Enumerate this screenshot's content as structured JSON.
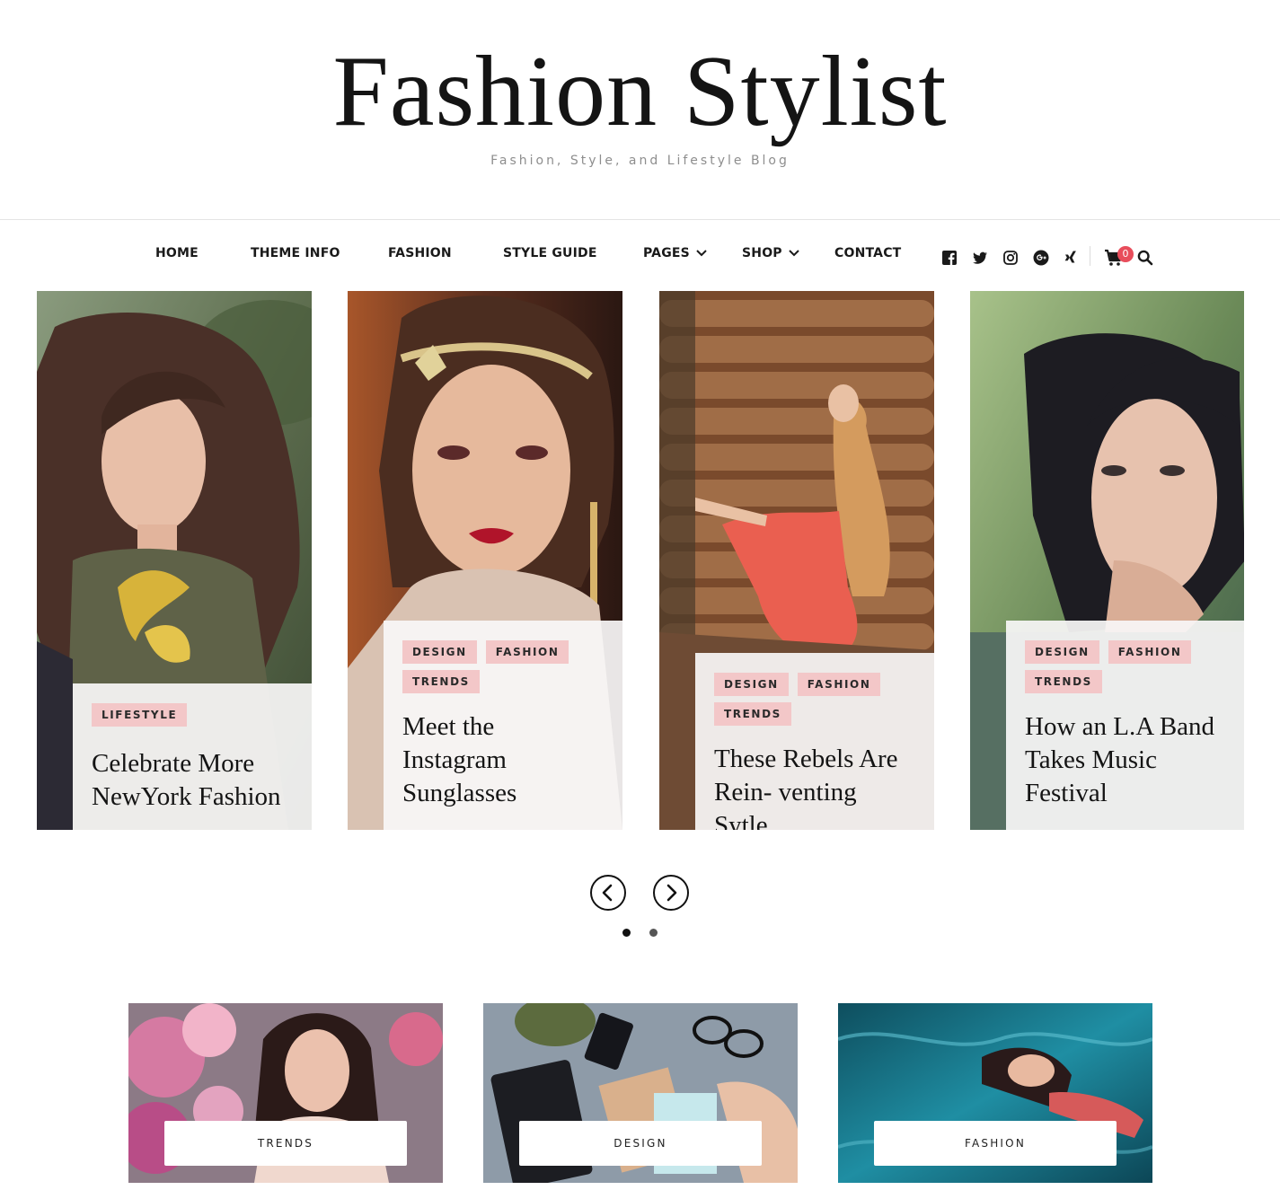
{
  "site": {
    "title": "Fashion Stylist",
    "tagline": "Fashion, Style, and Lifestyle Blog"
  },
  "nav": {
    "items": [
      {
        "label": "HOME"
      },
      {
        "label": "THEME INFO"
      },
      {
        "label": "FASHION"
      },
      {
        "label": "STYLE GUIDE"
      },
      {
        "label": "PAGES"
      },
      {
        "label": "SHOP"
      },
      {
        "label": "CONTACT"
      }
    ],
    "social_icons": [
      "facebook-icon",
      "twitter-icon",
      "instagram-icon",
      "google-plus-icon",
      "xing-icon"
    ],
    "cart_count": "0",
    "accent_color": "#e84d5b"
  },
  "slider": {
    "slides": [
      {
        "tags": [
          "LIFESTYLE"
        ],
        "title": "Celebrate More NewYork Fashion"
      },
      {
        "tags": [
          "DESIGN",
          "FASHION",
          "TRENDS"
        ],
        "title": "Meet the Instagram Sunglasses"
      },
      {
        "tags": [
          "DESIGN",
          "FASHION",
          "TRENDS"
        ],
        "title": "These Rebels Are Rein- venting Sytle"
      },
      {
        "tags": [
          "DESIGN",
          "FASHION",
          "TRENDS"
        ],
        "title": "How an L.A Band Takes Music Festival"
      }
    ],
    "tag_color": "#f3c7c8",
    "active_dot": 1,
    "dot_count": 2
  },
  "promos": [
    {
      "label": "TRENDS"
    },
    {
      "label": "DESIGN"
    },
    {
      "label": "FASHION"
    }
  ]
}
